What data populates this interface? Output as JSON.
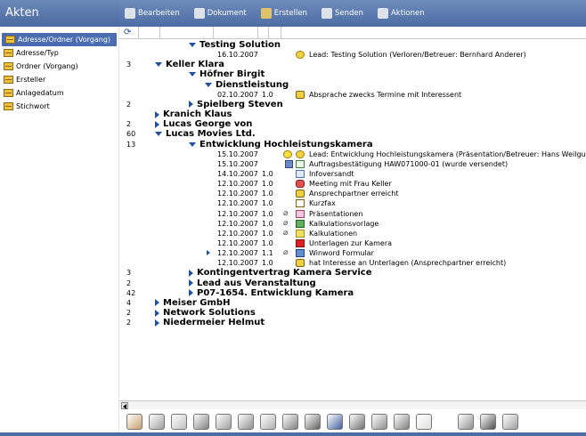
{
  "app_title": "Akten",
  "toolbar": {
    "items": [
      {
        "label": "Bearbeiten",
        "icon": "pencil-icon"
      },
      {
        "label": "Dokument",
        "icon": "new-document-icon"
      },
      {
        "label": "Erstellen",
        "icon": "create-icon"
      },
      {
        "label": "Senden",
        "icon": "send-icon"
      },
      {
        "label": "Aktionen",
        "icon": "actions-icon"
      }
    ]
  },
  "sidebar": {
    "items": [
      {
        "label": "Adresse/Ordner (Vorgang)",
        "active": true
      },
      {
        "label": "Adresse/Typ",
        "active": false
      },
      {
        "label": "Ordner (Vorgang)",
        "active": false
      },
      {
        "label": "Ersteller",
        "active": false
      },
      {
        "label": "Anlagedatum",
        "active": false
      },
      {
        "label": "Stichwort",
        "active": false
      }
    ]
  },
  "rows": [
    {
      "num": "",
      "node": "Testing Solution",
      "expanded": true
    },
    {
      "date": "16.10.2007",
      "ver": "",
      "icon": "lead-arrow-icon",
      "text": "Lead: Testing Solution (Verloren/Betreuer: Bernhard Anderer)"
    },
    {
      "num": "3",
      "node": "Keller Klara",
      "expanded": true
    },
    {
      "num": "",
      "node": "Höfner Birgit",
      "expanded": true
    },
    {
      "num": "",
      "node": "Dienstleistung",
      "expanded": true
    },
    {
      "date": "02.10.2007",
      "ver": "1.0",
      "icon": "phone-icon",
      "text": "Absprache zwecks Termine mit Interessent"
    },
    {
      "num": "2",
      "node": "Spielberg Steven",
      "expanded": false
    },
    {
      "num": "",
      "node": "Kranich Klaus",
      "expanded": false
    },
    {
      "num": "2",
      "node": "Lucas George von",
      "expanded": false
    },
    {
      "num": "60",
      "node": "Lucas Movies Ltd.",
      "expanded": true
    },
    {
      "num": "13",
      "node": "Entwicklung Hochleistungskamera",
      "expanded": true
    },
    {
      "date": "15.10.2007",
      "ver": "",
      "warn": true,
      "icon": "lead-arrow-icon",
      "text": "Lead: Entwicklung Hochleistungskamera (Präsentation/Betreuer: Hans Weilgut)"
    },
    {
      "date": "15.10.2007",
      "ver": "",
      "lock": true,
      "icon": "check-icon",
      "text": "Auftragsbestätigung HAW071000-01 (wurde versendet)"
    },
    {
      "date": "14.10.2007",
      "ver": "1.0",
      "icon": "mail-icon",
      "text": "Infoversandt"
    },
    {
      "date": "12.10.2007",
      "ver": "1.0",
      "icon": "people-icon",
      "text": "Meeting mit Frau Keller"
    },
    {
      "date": "12.10.2007",
      "ver": "1.0",
      "icon": "phone-icon",
      "text": "Ansprechpartner erreicht"
    },
    {
      "date": "12.10.2007",
      "ver": "1.0",
      "icon": "fax-icon",
      "text": "Kurzfax"
    },
    {
      "date": "12.10.2007",
      "ver": "1.0",
      "clip": true,
      "icon": "presentation-icon",
      "text": "Präsentationen"
    },
    {
      "date": "12.10.2007",
      "ver": "1.0",
      "clip": true,
      "icon": "calculation-icon",
      "text": "Kalkulationsvorlage"
    },
    {
      "date": "12.10.2007",
      "ver": "1.0",
      "clip": true,
      "icon": "note-icon",
      "text": "Kalkulationen"
    },
    {
      "date": "12.10.2007",
      "ver": "1.0",
      "icon": "document-icon",
      "text": "Unterlagen zur Kamera"
    },
    {
      "date": "12.10.2007",
      "ver": "1.1",
      "clip": true,
      "selected_marker": true,
      "icon": "word-icon",
      "text": "Winword Formular"
    },
    {
      "date": "12.10.2007",
      "ver": "1.0",
      "icon": "phone-icon",
      "text": "hat Interesse an Unterlagen (Ansprechpartner erreicht)"
    },
    {
      "num": "3",
      "node": "Kontingentvertrag Kamera Service",
      "expanded": false
    },
    {
      "num": "2",
      "node": "Lead aus Veranstaltung",
      "expanded": false
    },
    {
      "num": "42",
      "node": "P07-1654. Entwicklung Kamera",
      "expanded": false
    },
    {
      "num": "4",
      "node": "Meiser GmbH",
      "expanded": false
    },
    {
      "num": "2",
      "node": "Network Solutions",
      "expanded": false
    },
    {
      "num": "2",
      "node": "Niedermeier Helmut",
      "expanded": false
    }
  ],
  "bottom_icons": [
    "handshake-icon",
    "binder-icon",
    "contract-icon",
    "mail-pen-icon",
    "write-icon",
    "stamp-icon",
    "tool-icon",
    "quill-icon",
    "building-icon",
    "chart-icon",
    "org-icon",
    "clipboard-icon",
    "help-icon",
    "folder-icon",
    "home-icon",
    "info-icon",
    "print-icon"
  ]
}
